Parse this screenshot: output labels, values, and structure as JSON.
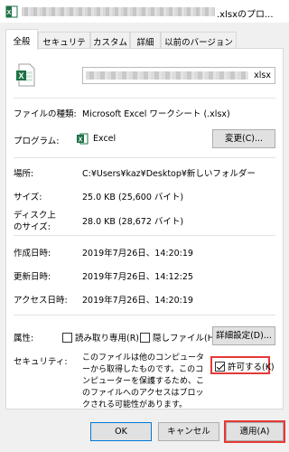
{
  "title": {
    "text": ".xlsxのプロ..."
  },
  "tabs": [
    "全般",
    "セキュリティ",
    "カスタム",
    "詳細",
    "以前のバージョン"
  ],
  "file": {
    "name_ext": "xlsx",
    "type_label": "ファイルの種類:",
    "type_value": "Microsoft Excel ワークシート (.xlsx)",
    "program_label": "プログラム:",
    "program_value": "Excel",
    "change_button": "変更(C)..."
  },
  "location": {
    "label": "場所:",
    "value": "C:¥Users¥kaz¥Desktop¥新しいフォルダー"
  },
  "size": {
    "label": "サイズ:",
    "value": "25.0 KB (25,600 バイト)"
  },
  "disk": {
    "label_line1": "ディスク上",
    "label_line2": "のサイズ:",
    "value": "28.0 KB (28,672 バイト)"
  },
  "dates": {
    "created_label": "作成日時:",
    "created_value": "2019年7月26日、14:20:19",
    "modified_label": "更新日時:",
    "modified_value": "2019年7月26日、14:12:25",
    "accessed_label": "アクセス日時:",
    "accessed_value": "2019年7月26日、14:20:19"
  },
  "attributes": {
    "label": "属性:",
    "readonly": "読み取り専用(R)",
    "hidden": "隠しファイル(H)",
    "advanced_button": "詳細設定(D)..."
  },
  "security": {
    "label": "セキュリティ:",
    "text": "このファイルは他のコンピューターから取得したものです。このコンピューターを保護するため、このファイルへのアクセスはブロックされる可能性があります。",
    "permit": "許可する(K)",
    "permit_checked": true
  },
  "buttons": {
    "ok": "OK",
    "cancel": "キャンセル",
    "apply": "適用(A)"
  },
  "colors": {
    "excel_green": "#1e7145",
    "highlight_red": "#e53935"
  }
}
